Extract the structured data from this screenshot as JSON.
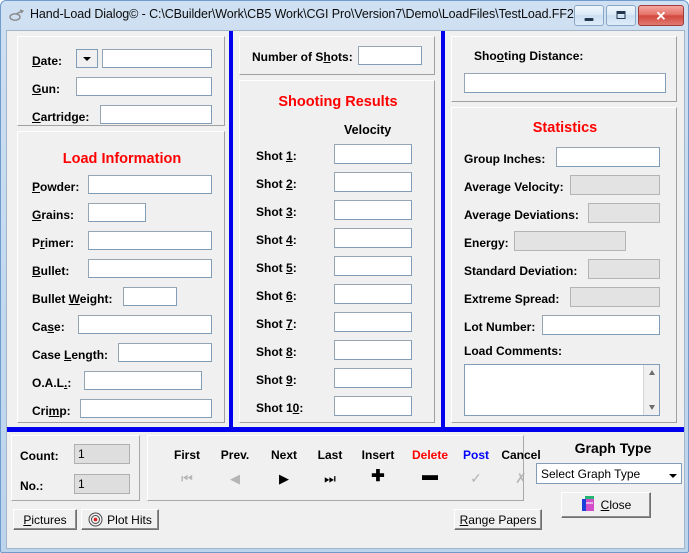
{
  "window": {
    "title": "Hand-Load Dialog© - C:\\CBuilder\\Work\\CB5 Work\\CGI Pro\\Version7\\Demo\\LoadFiles\\TestLoad.FF2",
    "minimize_label": "Minimize",
    "maximize_label": "Maximize",
    "close_label": "✕"
  },
  "colors": {
    "heading_red": "#ff0000",
    "splitter_blue": "#0000ee",
    "delete_red": "#ff0000",
    "post_blue": "#0000ff"
  },
  "left_panel": {
    "header_fields": [
      {
        "label": "Date",
        "acc": "D",
        "suffix": "ate:",
        "value": "",
        "has_dropdown": true
      },
      {
        "label": "Gun",
        "acc": "G",
        "suffix": "un:",
        "value": "",
        "has_dropdown": false
      },
      {
        "label": "Cartridge",
        "acc": "C",
        "suffix": "artridge:",
        "value": "",
        "has_dropdown": false
      }
    ],
    "load_information_title": "Load Information",
    "load_fields": [
      {
        "pre": "",
        "acc": "P",
        "post": "owder:",
        "value": ""
      },
      {
        "pre": "",
        "acc": "G",
        "post": "rains:",
        "value": ""
      },
      {
        "pre": "P",
        "acc": "r",
        "post": "imer:",
        "value": ""
      },
      {
        "pre": "",
        "acc": "B",
        "post": "ullet:",
        "value": ""
      },
      {
        "pre": "Bullet ",
        "acc": "W",
        "post": "eight:",
        "value": ""
      },
      {
        "pre": "Ca",
        "acc": "s",
        "post": "e:",
        "value": ""
      },
      {
        "pre": "Case ",
        "acc": "L",
        "post": "ength:",
        "value": ""
      },
      {
        "pre": "O.A.L",
        "acc": ".",
        "post": ":",
        "value": ""
      },
      {
        "pre": "Cri",
        "acc": "m",
        "post": "p:",
        "value": ""
      }
    ]
  },
  "middle_panel": {
    "number_of_shots": {
      "pre": "Number of S",
      "acc": "h",
      "post": "ots:",
      "value": ""
    },
    "shooting_results_title": "Shooting Results",
    "velocity_header": "Velocity",
    "shots": [
      {
        "pre": "Shot ",
        "acc": "1",
        "post": ":",
        "value": ""
      },
      {
        "pre": "Shot ",
        "acc": "2",
        "post": ":",
        "value": ""
      },
      {
        "pre": "Shot ",
        "acc": "3",
        "post": ":",
        "value": ""
      },
      {
        "pre": "Shot ",
        "acc": "4",
        "post": ":",
        "value": ""
      },
      {
        "pre": "Shot ",
        "acc": "5",
        "post": ":",
        "value": ""
      },
      {
        "pre": "Shot ",
        "acc": "6",
        "post": ":",
        "value": ""
      },
      {
        "pre": "Shot ",
        "acc": "7",
        "post": ":",
        "value": ""
      },
      {
        "pre": "Shot ",
        "acc": "8",
        "post": ":",
        "value": ""
      },
      {
        "pre": "Shot ",
        "acc": "9",
        "post": ":",
        "value": ""
      },
      {
        "pre": "Shot 1",
        "acc": "0",
        "post": ":",
        "value": ""
      }
    ]
  },
  "right_panel": {
    "shooting_distance": {
      "pre": "Sho",
      "acc": "o",
      "post": "ting Distance:",
      "value": ""
    },
    "statistics_title": "Statistics",
    "stats": [
      {
        "label": "Group Inches:",
        "value": "",
        "readonly": false
      },
      {
        "label": "Average Velocity:",
        "value": "",
        "readonly": true
      },
      {
        "label": "Average Deviations:",
        "value": "",
        "readonly": true
      },
      {
        "label": "Energy:",
        "value": "",
        "readonly": true
      },
      {
        "label": "Standard Deviation:",
        "value": "",
        "readonly": true
      },
      {
        "label": "Extreme Spread:",
        "value": "",
        "readonly": true
      }
    ],
    "lot_number": {
      "label": "Lot Number:",
      "value": ""
    },
    "load_comments": {
      "label": "Load Comments:",
      "value": ""
    }
  },
  "bottom": {
    "count": {
      "label": "Count:",
      "value": "1"
    },
    "no": {
      "label": "No.:",
      "value": "1"
    },
    "pictures_button": {
      "pre": "",
      "acc": "P",
      "post": "ictures"
    },
    "plot_hits_button": {
      "label": "Plot Hits",
      "icon": "bullseye-icon"
    },
    "range_papers_button": {
      "pre": "",
      "acc": "R",
      "post": "ange Papers"
    },
    "nav_buttons": [
      {
        "label": "First",
        "icon": "⏮",
        "color": "black",
        "dim": true
      },
      {
        "label": "Prev.",
        "icon": "◀",
        "color": "black",
        "dim": true
      },
      {
        "label": "Next",
        "icon": "▶",
        "color": "black",
        "dim": false
      },
      {
        "label": "Last",
        "icon": "⏭",
        "color": "black",
        "dim": false
      },
      {
        "label": "Insert",
        "icon": "✚",
        "color": "black",
        "dim": false
      },
      {
        "label": "Delete",
        "icon": "▬",
        "color": "red",
        "dim": false
      },
      {
        "label": "Post",
        "icon": "✓",
        "color": "blue",
        "dim": true
      },
      {
        "label": "Cancel",
        "icon": "✗",
        "color": "black",
        "dim": true
      }
    ],
    "graph_type_title": "Graph Type",
    "graph_type_value": "Select Graph Type",
    "close_button": {
      "pre": "",
      "acc": "C",
      "post": "lose"
    }
  }
}
